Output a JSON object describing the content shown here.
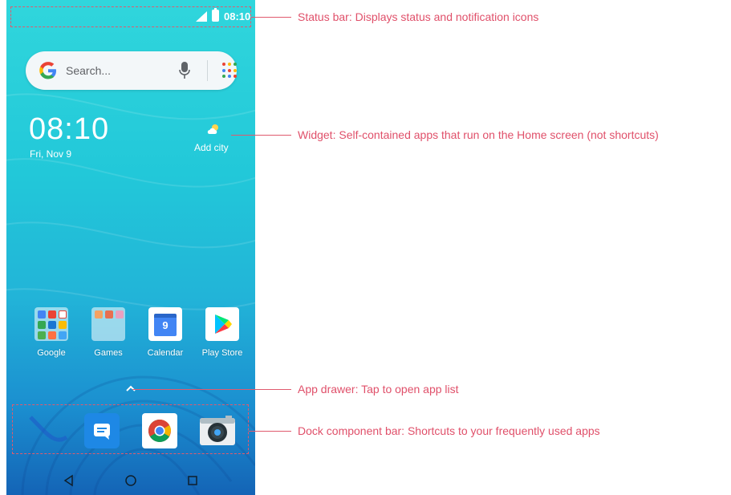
{
  "status_bar": {
    "time": "08:10",
    "icons": [
      "cellular-signal-icon",
      "battery-icon"
    ]
  },
  "search": {
    "placeholder": "Search..."
  },
  "widget": {
    "time": "08:10",
    "date": "Fri, Nov 9",
    "add_city": "Add city",
    "weather_icon": "weather-cloud-icon"
  },
  "apps": [
    {
      "label": "Google",
      "icon": "google-folder-icon"
    },
    {
      "label": "Games",
      "icon": "games-folder-icon"
    },
    {
      "label": "Calendar",
      "icon": "calendar-icon"
    },
    {
      "label": "Play Store",
      "icon": "play-store-icon"
    }
  ],
  "dock": [
    {
      "icon": "messages-icon"
    },
    {
      "icon": "chrome-icon"
    },
    {
      "icon": "camera-icon"
    }
  ],
  "navigation": [
    "back-icon",
    "home-icon",
    "recents-icon"
  ],
  "callouts": {
    "status_bar": "Status bar: Displays status and notification icons",
    "widget": "Widget: Self-contained apps that run on the Home screen (not shortcuts)",
    "app_drawer": "App drawer: Tap to open app list",
    "dock": "Dock component bar: Shortcuts to your frequently used apps"
  },
  "colors": {
    "annotation": "#e0506a",
    "wallpaper_top": "#30d6dc",
    "wallpaper_bottom": "#1464b6"
  }
}
